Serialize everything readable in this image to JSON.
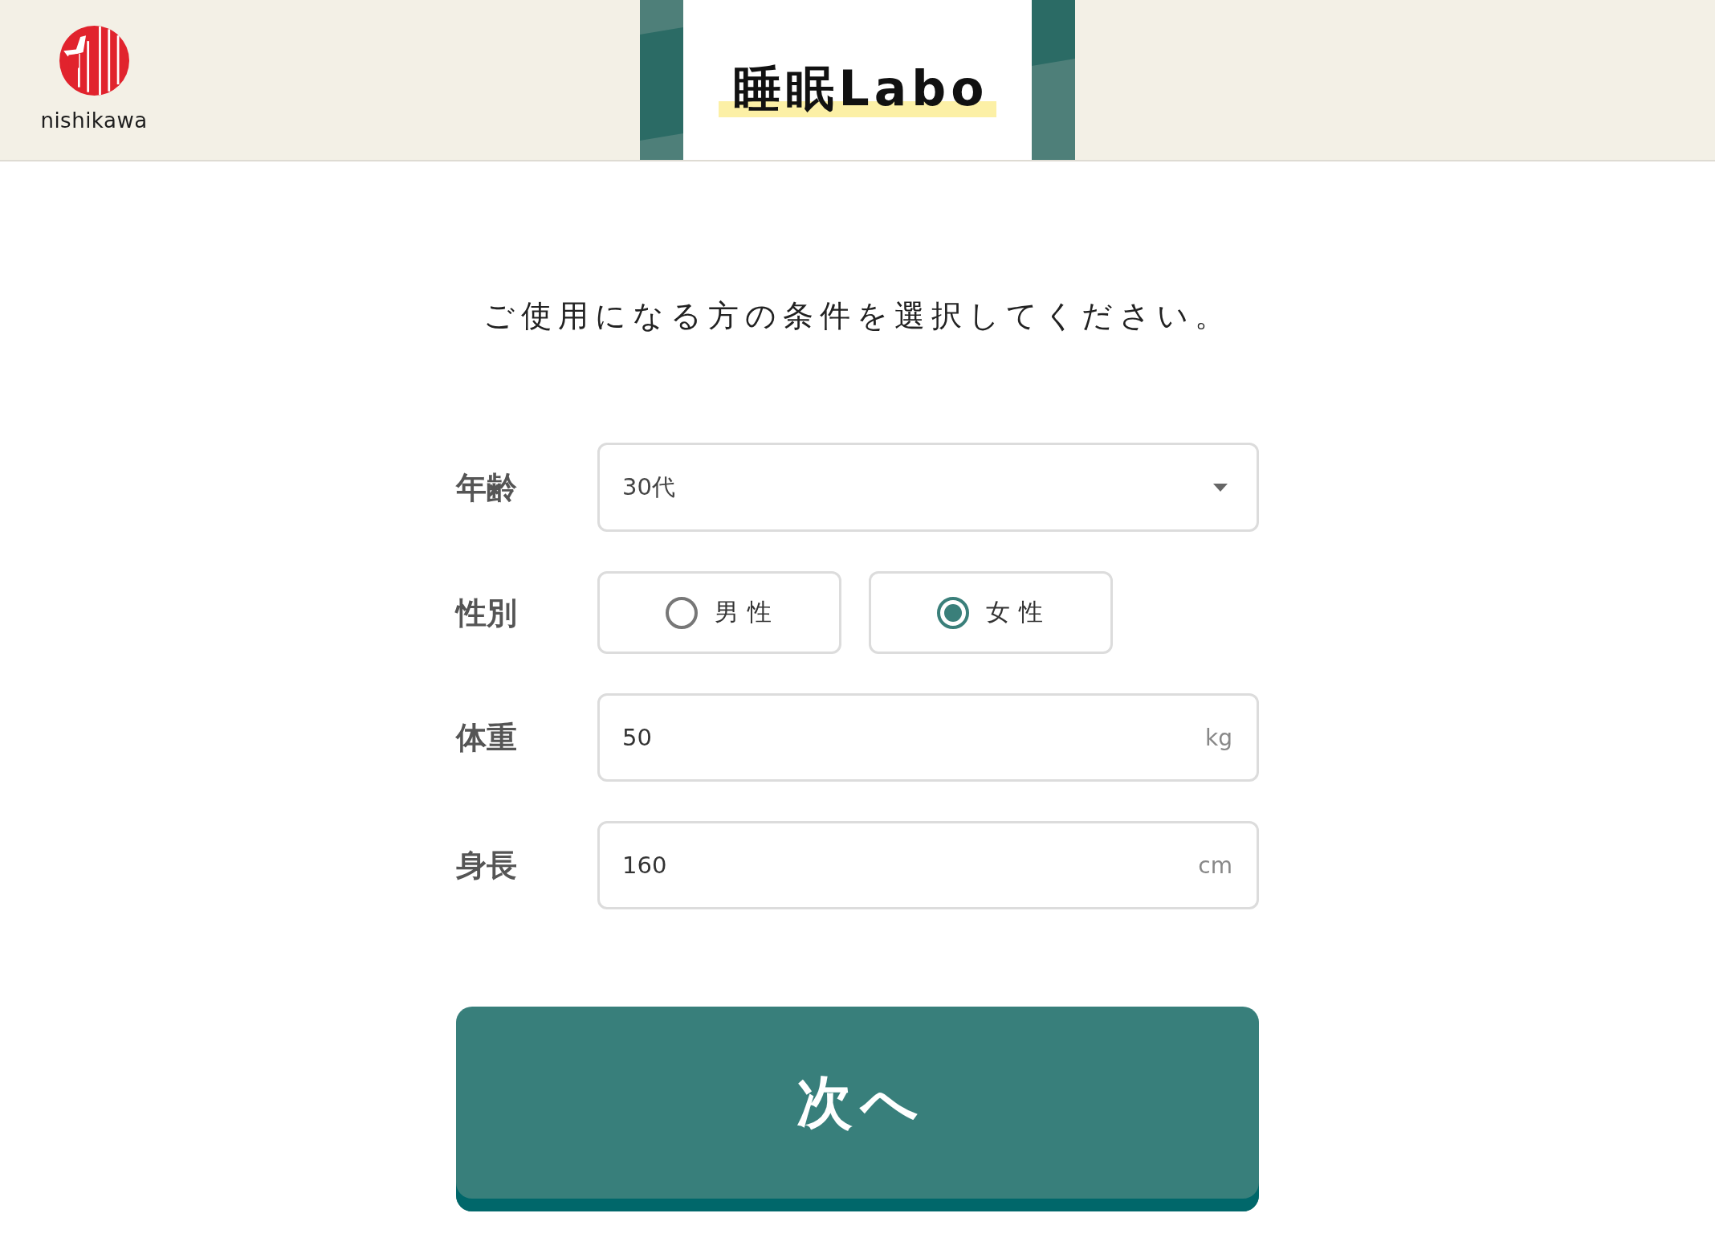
{
  "header": {
    "logo_text": "nishikawa",
    "site_title": "睡眠Labo"
  },
  "instruction": "ご使用になる方の条件を選択してください。",
  "form": {
    "fields": [
      {
        "kind": "select",
        "label": "年齢",
        "value": "30代"
      },
      {
        "kind": "radio",
        "label": "性別",
        "options": [
          {
            "label": "男性",
            "selected": false
          },
          {
            "label": "女性",
            "selected": true
          }
        ]
      },
      {
        "kind": "number",
        "label": "体重",
        "value": "50",
        "unit": "kg"
      },
      {
        "kind": "number",
        "label": "身長",
        "value": "160",
        "unit": "cm"
      }
    ]
  },
  "next_button": "次へ"
}
